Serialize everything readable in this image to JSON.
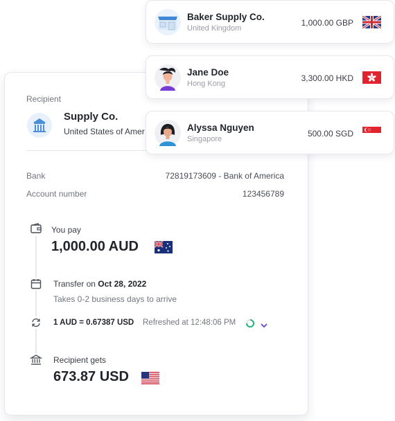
{
  "transfer": {
    "recipient_label": "Recipient",
    "recipient_name": "Supply Co.",
    "recipient_country": "United States of Amer",
    "bank_label": "Bank",
    "bank_value": "72819173609 - Bank of America",
    "account_label": "Account number",
    "account_value": "123456789",
    "you_pay_label": "You pay",
    "you_pay_amount": "1,000.00 AUD",
    "transfer_on_label": "Transfer on",
    "transfer_date": "Oct 28, 2022",
    "transfer_eta": "Takes 0-2 business days to arrive",
    "rate": "1 AUD = 0.67387 USD",
    "refreshed": "Refreshed at 12:48:06 PM",
    "recipient_gets_label": "Recipient gets",
    "recipient_gets_amount": "673.87 USD"
  },
  "recipients": [
    {
      "name": "Baker Supply Co.",
      "country": "United Kingdom",
      "amount": "1,000.00 GBP",
      "flag": "uk-flag-icon",
      "avatar": "storefront-icon"
    },
    {
      "name": "Jane Doe",
      "country": "Hong Kong",
      "amount": "3,300.00 HKD",
      "flag": "hong-kong-flag-icon",
      "avatar": "woman-avatar-icon"
    },
    {
      "name": "Alyssa Nguyen",
      "country": "Singapore",
      "amount": "500.00 SGD",
      "flag": "singapore-flag-icon",
      "avatar": "woman-avatar-icon"
    }
  ],
  "colors": {
    "accent_purple": "#6b3fd1",
    "spinner_green": "#1db87a",
    "text_dark": "#22252b",
    "text_muted": "#73767f"
  }
}
